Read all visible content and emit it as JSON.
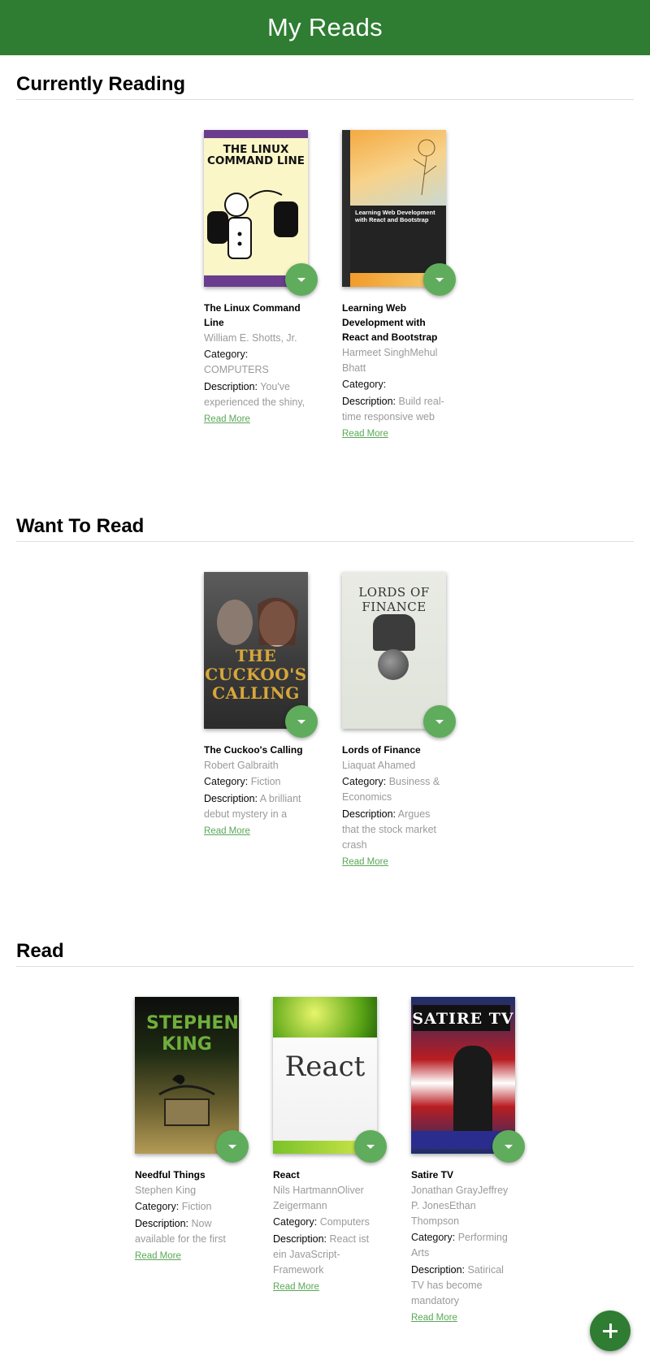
{
  "app": {
    "title": "My Reads"
  },
  "labels": {
    "category": "Category:",
    "description": "Description:",
    "read_more": "Read More"
  },
  "shelves": [
    {
      "title": "Currently Reading",
      "books": [
        {
          "title": "The Linux Command Line",
          "authors": "William E. Shotts, Jr.",
          "category": "COMPUTERS",
          "description": "You've experienced the shiny,",
          "cover_text": "THE LINUX COMMAND LINE"
        },
        {
          "title": "Learning Web Development with React and Bootstrap",
          "authors": "Harmeet SinghMehul Bhatt",
          "category": "",
          "description": "Build real-time responsive web",
          "cover_text": "Learning Web Development with React and Bootstrap"
        }
      ]
    },
    {
      "title": "Want To Read",
      "books": [
        {
          "title": "The Cuckoo's Calling",
          "authors": "Robert Galbraith",
          "category": "Fiction",
          "description": "A brilliant debut mystery in a",
          "cover_text": "THE CUCKOO'S CALLING"
        },
        {
          "title": "Lords of Finance",
          "authors": "Liaquat Ahamed",
          "category": "Business & Economics",
          "description": "Argues that the stock market crash",
          "cover_text": "LORDS OF FINANCE"
        }
      ]
    },
    {
      "title": "Read",
      "books": [
        {
          "title": "Needful Things",
          "authors": "Stephen King",
          "category": "Fiction",
          "description": "Now available for the first",
          "cover_text": "STEPHEN KING"
        },
        {
          "title": "React",
          "authors": "Nils HartmannOliver Zeigermann",
          "category": "Computers",
          "description": "React ist ein JavaScript-Framework",
          "cover_text": "React"
        },
        {
          "title": "Satire TV",
          "authors": "Jonathan GrayJeffrey P. JonesEthan Thompson",
          "category": "Performing Arts",
          "description": "Satirical TV has become mandatory",
          "cover_text": "SATIRE TV"
        }
      ]
    }
  ],
  "colors": {
    "header": "#2e7d32",
    "changer": "#60ac5d",
    "link": "#5aa857"
  },
  "icons": {
    "shelf_changer": "arrow-drop-down-icon",
    "add_book": "plus-icon"
  }
}
